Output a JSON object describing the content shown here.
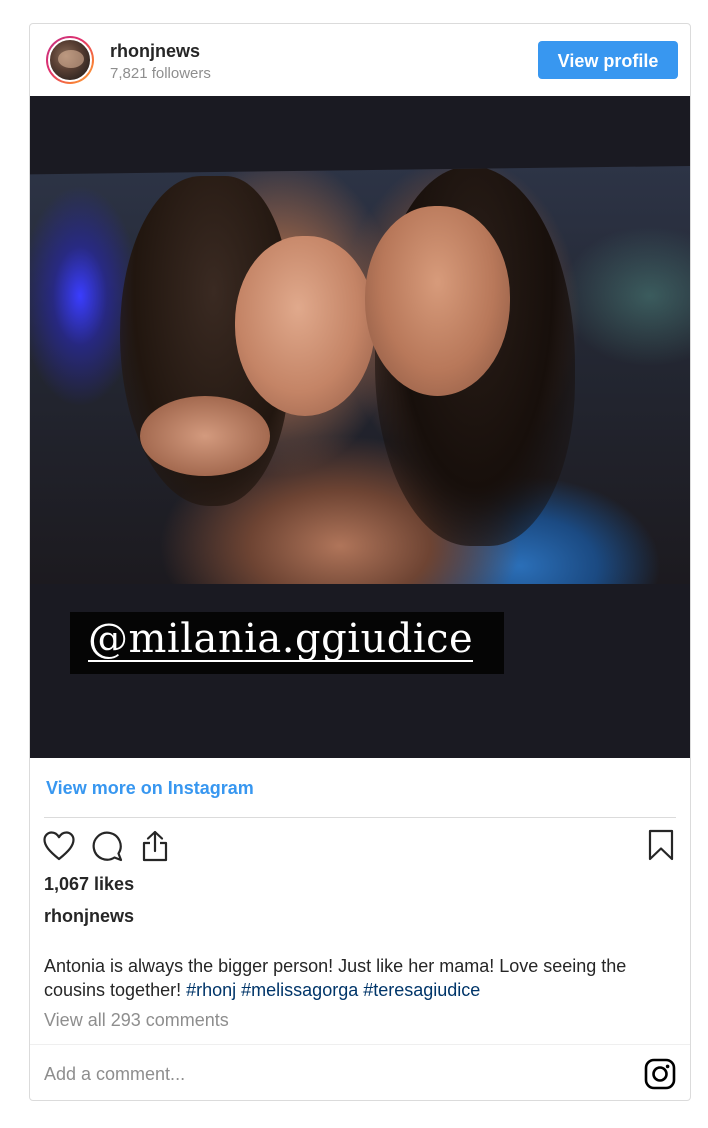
{
  "header": {
    "username": "rhonjnews",
    "followers": "7,821 followers",
    "view_profile_label": "View profile"
  },
  "media": {
    "sticker_text": "@milania.ggiudice"
  },
  "links": {
    "view_more_label": "View more on Instagram"
  },
  "actions": {
    "icons": [
      "heart-icon",
      "comment-icon",
      "share-icon",
      "bookmark-icon"
    ]
  },
  "post": {
    "likes": "1,067 likes",
    "author": "rhonjnews",
    "caption_text": "Antonia is always the bigger person! Just like her mama! Love seeing the cousins together! ",
    "hashtags": [
      "#rhonj",
      "#melissagorga",
      "#teresagiudice"
    ],
    "view_comments_label": "View all 293 comments"
  },
  "comment": {
    "placeholder": "Add a comment..."
  },
  "colors": {
    "accent": "#3897f0",
    "hashtag": "#003569",
    "muted": "#8e8e8e",
    "text": "#262626",
    "border": "#dbdbdb"
  }
}
